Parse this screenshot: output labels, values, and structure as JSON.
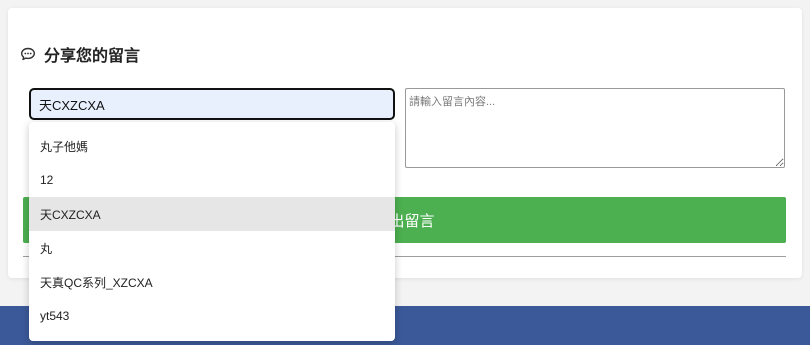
{
  "form": {
    "title": "分享您的留言",
    "title_icon": "speech-bubble-icon",
    "name_value": "天CXZCXA",
    "message_placeholder": "請輸入留言內容...",
    "submit_label": "送出留言"
  },
  "autocomplete": {
    "options": [
      "丸子他媽",
      "12",
      "天CXZCXA",
      "丸",
      "天真QC系列_XZCXA",
      "yt543"
    ],
    "selected_index": 2
  },
  "colors": {
    "accent_green": "#4caf50",
    "footer_blue": "#3b5998",
    "input_bg": "#e8f0fe",
    "selected_bg": "#e6e6e6"
  }
}
